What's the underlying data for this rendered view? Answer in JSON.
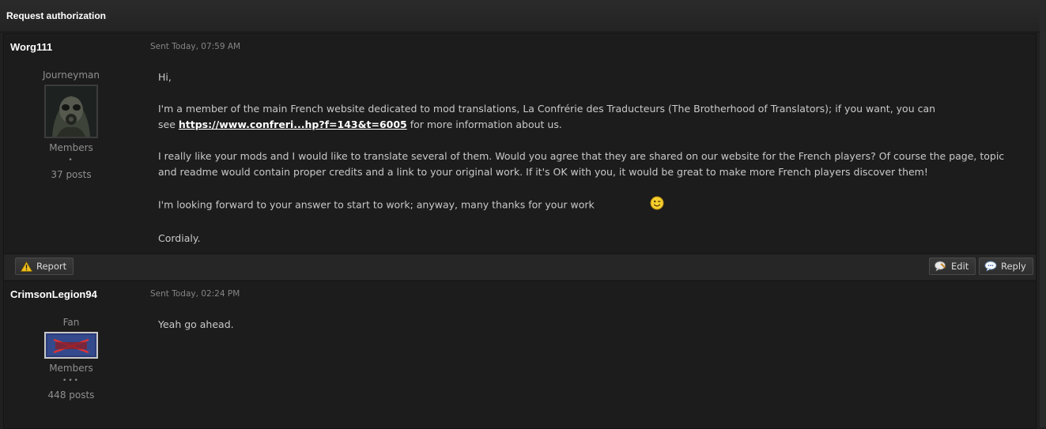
{
  "header": {
    "title": "Request authorization"
  },
  "messages": [
    {
      "author": "Worg111",
      "sent": "Sent Today, 07:59 AM",
      "rank": "Journeyman",
      "group": "Members",
      "pips": "•",
      "posts": "37 posts",
      "body": {
        "p1": "Hi,",
        "p2_line1": "I'm a member of the main French website dedicated to mod translations, La Confrérie des Traducteurs (The Brotherhood of Translators); if you want, you can",
        "p2_see": "see ",
        "p2_link": "https://www.confreri...hp?f=143&t=6005",
        "p2_after": " for more information about us.",
        "p3": "I really like your mods and I would like to translate several of them. Would you agree that they are shared on our website for the French players? Of course the page, topic and readme would contain proper credits and a link to your original work. If it's OK with you, it would be great to make more French players discover them!",
        "p4": "I'm looking forward to your answer to start to work; anyway, many thanks for your work",
        "p5": "Cordialy."
      },
      "actions": {
        "report": "Report",
        "edit": "Edit",
        "reply": "Reply"
      }
    },
    {
      "author": "CrimsonLegion94",
      "sent": "Sent Today, 02:24 PM",
      "rank": "Fan",
      "group": "Members",
      "pips": "•••",
      "posts": "448 posts",
      "body": {
        "p1": "Yeah go ahead."
      }
    }
  ],
  "icons": {
    "report": "warning-triangle-icon",
    "edit": "speech-bubble-pencil-icon",
    "reply": "speech-bubble-icon",
    "smiley": "wink-smiley-icon"
  },
  "colors": {
    "background": "#202020",
    "panel": "#1c1c1c",
    "link": "#ffffff",
    "warning": "#f2c01d"
  }
}
